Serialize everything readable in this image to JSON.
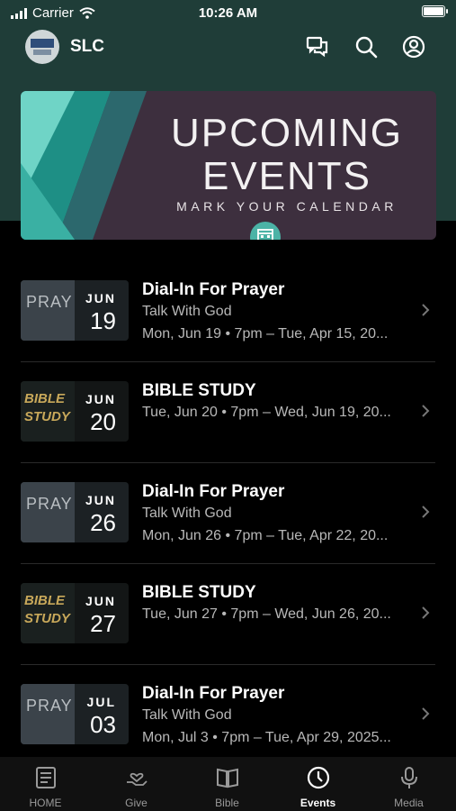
{
  "status_bar": {
    "carrier": "Carrier",
    "time": "10:26 AM"
  },
  "header": {
    "title": "SLC",
    "icons": [
      "chat-bubbles-icon",
      "search-icon",
      "profile-icon"
    ]
  },
  "banner": {
    "line1": "UPCOMING",
    "line2": "EVENTS",
    "subtitle": "MARK YOUR CALENDAR"
  },
  "events": [
    {
      "title": "Dial-In For Prayer",
      "subtitle": "Talk With God",
      "date": "Mon, Jun 19 • 7pm – Tue, Apr 15, 20...",
      "month": "JUN",
      "day": "19",
      "thumb": "PRAY"
    },
    {
      "title": "BIBLE STUDY",
      "subtitle": "",
      "date": "Tue, Jun 20 • 7pm – Wed, Jun 19, 20...",
      "month": "JUN",
      "day": "20",
      "thumb": "BIBLE STUDY"
    },
    {
      "title": "Dial-In For Prayer",
      "subtitle": "Talk With God",
      "date": "Mon, Jun 26 • 7pm – Tue, Apr 22, 20...",
      "month": "JUN",
      "day": "26",
      "thumb": "PRAY"
    },
    {
      "title": "BIBLE STUDY",
      "subtitle": "",
      "date": "Tue, Jun 27 • 7pm – Wed, Jun 26, 20...",
      "month": "JUN",
      "day": "27",
      "thumb": "BIBLE STUDY"
    },
    {
      "title": "Dial-In For Prayer",
      "subtitle": "Talk With God",
      "date": "Mon, Jul 3 • 7pm – Tue, Apr 29, 2025...",
      "month": "JUL",
      "day": "03",
      "thumb": "PRAY"
    }
  ],
  "tabs": [
    {
      "label": "HOME",
      "icon": "home-icon",
      "active": false
    },
    {
      "label": "Give",
      "icon": "give-icon",
      "active": false
    },
    {
      "label": "Bible",
      "icon": "bible-icon",
      "active": false
    },
    {
      "label": "Events",
      "icon": "clock-icon",
      "active": true
    },
    {
      "label": "Media",
      "icon": "microphone-icon",
      "active": false
    }
  ],
  "colors": {
    "header_bg": "#1f3d38",
    "accent": "#4bb3a6",
    "background": "#000000"
  }
}
